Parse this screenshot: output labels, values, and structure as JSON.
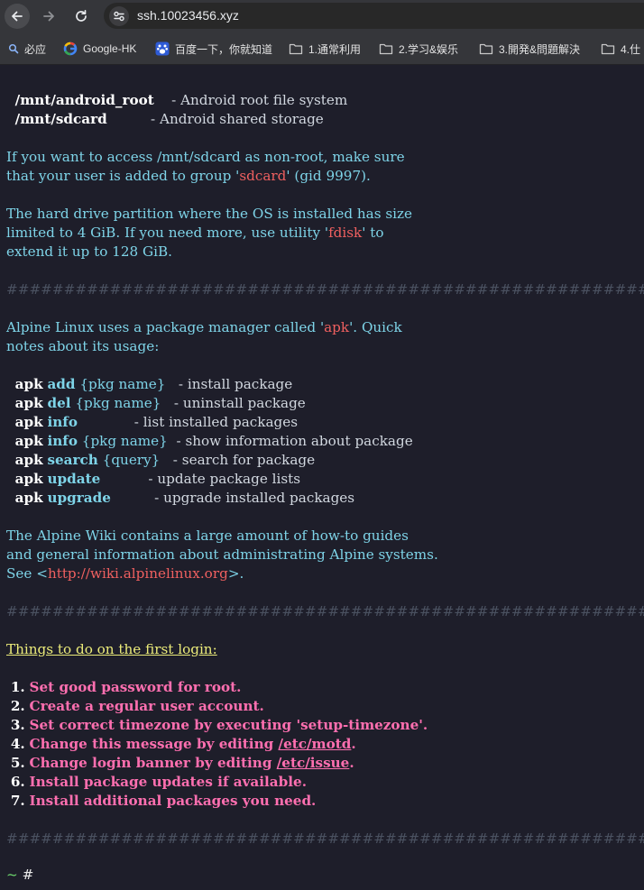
{
  "browser": {
    "url": "ssh.10023456.xyz",
    "bookmarks": [
      {
        "label": "必应",
        "icon": "search-icon"
      },
      {
        "label": "Google-HK",
        "icon": "google-icon"
      },
      {
        "label": "百度一下，你就知道",
        "icon": "baidu-paw-icon"
      },
      {
        "label": "1.通常利用",
        "icon": "folder-icon"
      },
      {
        "label": "2.学习&娱乐",
        "icon": "folder-icon"
      },
      {
        "label": "3.開発&問題解決",
        "icon": "folder-icon"
      },
      {
        "label": "4.仕",
        "icon": "folder-icon"
      }
    ]
  },
  "terminal": {
    "mounts": [
      {
        "path": "/mnt/android_root",
        "sep": "    - ",
        "desc": "Android root file system"
      },
      {
        "path": "/mnt/sdcard",
        "sep": "          - ",
        "desc": "Android shared storage"
      }
    ],
    "sdcard_note": {
      "line1": "If you want to access /mnt/sdcard as non-root, make sure",
      "line2_a": "that your user is added to group '",
      "line2_b": "sdcard",
      "line2_c": "' (gid 9997)."
    },
    "partition_note": {
      "line1": "The hard drive partition where the OS is installed has size",
      "line2_a": "limited to 4 GiB. If you need more, use utility '",
      "line2_b": "fdisk",
      "line2_c": "' to",
      "line3": "extend it up to 128 GiB."
    },
    "separator": "############################################################",
    "apk_intro": {
      "line1_a": "Alpine Linux uses a package manager called '",
      "line1_b": "apk",
      "line1_c": "'. Quick",
      "line2": "notes about its usage:"
    },
    "apk_commands": [
      {
        "cmd": "apk",
        "sub": "add",
        "arg": "{pkg name}",
        "pad": "   - ",
        "desc": "install package"
      },
      {
        "cmd": "apk",
        "sub": "del",
        "arg": "{pkg name}",
        "pad": "   - ",
        "desc": "uninstall package"
      },
      {
        "cmd": "apk",
        "sub": "info",
        "arg": "",
        "pad": "             - ",
        "desc": "list installed packages"
      },
      {
        "cmd": "apk",
        "sub": "info",
        "arg": "{pkg name}",
        "pad": "  - ",
        "desc": "show information about package"
      },
      {
        "cmd": "apk",
        "sub": "search",
        "arg": "{query}",
        "pad": "   - ",
        "desc": "search for package"
      },
      {
        "cmd": "apk",
        "sub": "update",
        "arg": "",
        "pad": "           - ",
        "desc": "update package lists"
      },
      {
        "cmd": "apk",
        "sub": "upgrade",
        "arg": "",
        "pad": "          - ",
        "desc": "upgrade installed packages"
      }
    ],
    "wiki_note": {
      "line1": "The Alpine Wiki contains a large amount of how-to guides",
      "line2": "and general information about administrating Alpine systems.",
      "line3_a": "See <",
      "line3_b": "http://wiki.alpinelinux.org",
      "line3_c": ">."
    },
    "todo_heading": "Things to do on the first login:",
    "todo": [
      {
        "num": "1.",
        "a": "Set good password for root.",
        "link": "",
        "b": ""
      },
      {
        "num": "2.",
        "a": "Create a regular user account.",
        "link": "",
        "b": ""
      },
      {
        "num": "3.",
        "a": "Set correct timezone by executing 'setup-timezone'.",
        "link": "",
        "b": ""
      },
      {
        "num": "4.",
        "a": "Change this message by editing ",
        "link": "/etc/motd",
        "b": "."
      },
      {
        "num": "5.",
        "a": "Change login banner by editing ",
        "link": "/etc/issue",
        "b": "."
      },
      {
        "num": "6.",
        "a": "Install package updates if available.",
        "link": "",
        "b": ""
      },
      {
        "num": "7.",
        "a": "Install additional packages you need.",
        "link": "",
        "b": ""
      }
    ],
    "prompt": {
      "dir": "~",
      "symbol": "#"
    }
  }
}
